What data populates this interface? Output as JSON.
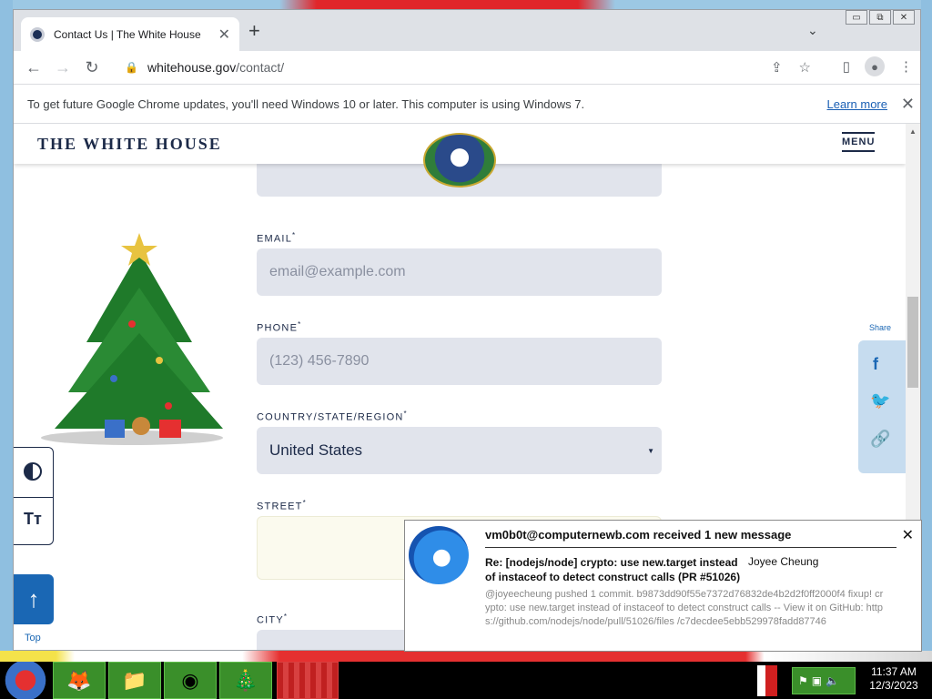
{
  "browser": {
    "tab_title": "Contact Us | The White House",
    "tab_close": "✕",
    "new_tab": "+",
    "url_host": "whitehouse.gov",
    "url_path": "/contact/",
    "window_controls": [
      "▭",
      "⧉",
      "✕"
    ]
  },
  "infobar": {
    "message": "To get future Google Chrome updates, you'll need Windows 10 or later. This computer is using Windows 7.",
    "link": "Learn more",
    "close": "✕"
  },
  "site": {
    "title": "THE WHITE HOUSE",
    "menu": "MENU"
  },
  "form": {
    "email_label": "EMAIL",
    "email_placeholder": "email@example.com",
    "phone_label": "PHONE",
    "phone_placeholder": "(123) 456-7890",
    "country_label": "COUNTRY/STATE/REGION",
    "country_value": "United States",
    "street_label": "STREET",
    "city_label": "CITY",
    "required_mark": "*"
  },
  "sidebar": {
    "text_size": "Tт",
    "top_arrow": "↑",
    "top_label": "Top"
  },
  "share": {
    "label": "Share",
    "facebook": "f",
    "twitter": "🐦",
    "link": "🔗"
  },
  "notification": {
    "header": "vm0b0t@computernewb.com received 1 new message",
    "subject": "Re: [nodejs/node] crypto: use new.target instead of instaceof to detect construct calls (PR #51026)",
    "from": "Joyee Cheung",
    "body": "@joyeecheung pushed 1 commit. b9873dd90f55e7372d76832de4b2d2f0ff2000f4 fixup! crypto: use new.target instead of instaceof to detect construct calls -- View it on GitHub: https://github.com/nodejs/node/pull/51026/files /c7decdee5ebb529978fadd87746",
    "close": "✕"
  },
  "taskbar": {
    "time": "11:37 AM",
    "date": "12/3/2023"
  }
}
